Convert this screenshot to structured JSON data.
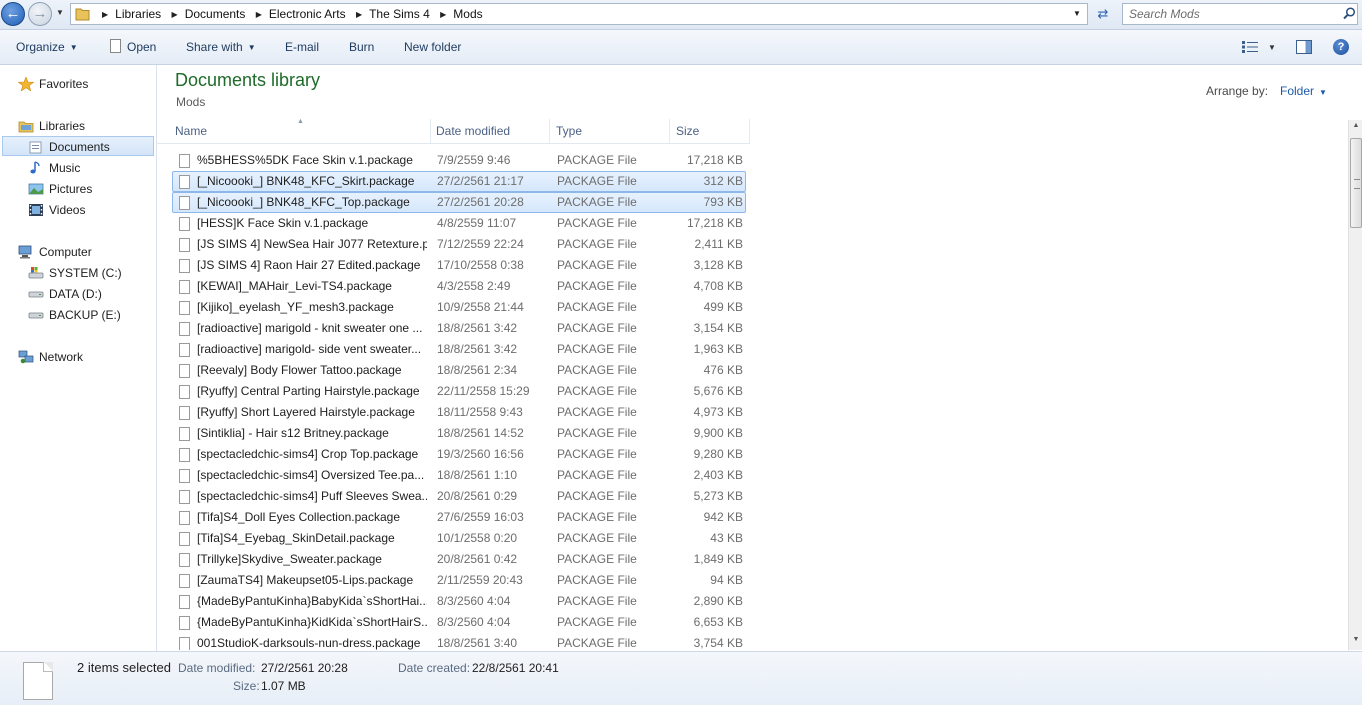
{
  "address": {
    "crumbs": [
      "Libraries",
      "Documents",
      "Electronic Arts",
      "The Sims 4",
      "Mods"
    ]
  },
  "search": {
    "placeholder": "Search Mods"
  },
  "toolbar": {
    "organize": "Organize",
    "open": "Open",
    "share_with": "Share with",
    "email": "E-mail",
    "burn": "Burn",
    "new_folder": "New folder"
  },
  "sidebar": {
    "favorites": "Favorites",
    "libraries": "Libraries",
    "documents": "Documents",
    "music": "Music",
    "pictures": "Pictures",
    "videos": "Videos",
    "computer": "Computer",
    "drive_c": "SYSTEM (C:)",
    "drive_d": "DATA (D:)",
    "drive_e": "BACKUP (E:)",
    "network": "Network"
  },
  "content": {
    "title": "Documents library",
    "subtitle": "Mods",
    "arrange_label": "Arrange by:",
    "arrange_value": "Folder"
  },
  "columns": {
    "name": "Name",
    "date": "Date modified",
    "type": "Type",
    "size": "Size"
  },
  "files": [
    {
      "name": "%5BHESS%5DK Face Skin v.1.package",
      "date": "7/9/2559 9:46",
      "type": "PACKAGE File",
      "size": "17,218 KB",
      "selected": false
    },
    {
      "name": "[_Nicoooki_] BNK48_KFC_Skirt.package",
      "date": "27/2/2561 21:17",
      "type": "PACKAGE File",
      "size": "312 KB",
      "selected": true
    },
    {
      "name": "[_Nicoooki_] BNK48_KFC_Top.package",
      "date": "27/2/2561 20:28",
      "type": "PACKAGE File",
      "size": "793 KB",
      "selected": true
    },
    {
      "name": "[HESS]K Face Skin v.1.package",
      "date": "4/8/2559 11:07",
      "type": "PACKAGE File",
      "size": "17,218 KB",
      "selected": false
    },
    {
      "name": "[JS SIMS 4] NewSea Hair J077 Retexture.p...",
      "date": "7/12/2559 22:24",
      "type": "PACKAGE File",
      "size": "2,411 KB",
      "selected": false
    },
    {
      "name": "[JS SIMS 4] Raon Hair 27 Edited.package",
      "date": "17/10/2558 0:38",
      "type": "PACKAGE File",
      "size": "3,128 KB",
      "selected": false
    },
    {
      "name": "[KEWAI]_MAHair_Levi-TS4.package",
      "date": "4/3/2558 2:49",
      "type": "PACKAGE File",
      "size": "4,708 KB",
      "selected": false
    },
    {
      "name": "[Kijiko]_eyelash_YF_mesh3.package",
      "date": "10/9/2558 21:44",
      "type": "PACKAGE File",
      "size": "499 KB",
      "selected": false
    },
    {
      "name": "[radioactive] marigold - knit sweater one ...",
      "date": "18/8/2561 3:42",
      "type": "PACKAGE File",
      "size": "3,154 KB",
      "selected": false
    },
    {
      "name": "[radioactive] marigold- side vent sweater...",
      "date": "18/8/2561 3:42",
      "type": "PACKAGE File",
      "size": "1,963 KB",
      "selected": false
    },
    {
      "name": "[Reevaly] Body Flower Tattoo.package",
      "date": "18/8/2561 2:34",
      "type": "PACKAGE File",
      "size": "476 KB",
      "selected": false
    },
    {
      "name": "[Ryuffy] Central Parting Hairstyle.package",
      "date": "22/11/2558 15:29",
      "type": "PACKAGE File",
      "size": "5,676 KB",
      "selected": false
    },
    {
      "name": "[Ryuffy] Short Layered Hairstyle.package",
      "date": "18/11/2558 9:43",
      "type": "PACKAGE File",
      "size": "4,973 KB",
      "selected": false
    },
    {
      "name": "[Sintiklia] - Hair s12 Britney.package",
      "date": "18/8/2561 14:52",
      "type": "PACKAGE File",
      "size": "9,900 KB",
      "selected": false
    },
    {
      "name": "[spectacledchic-sims4] Crop Top.package",
      "date": "19/3/2560 16:56",
      "type": "PACKAGE File",
      "size": "9,280 KB",
      "selected": false
    },
    {
      "name": "[spectacledchic-sims4] Oversized Tee.pa...",
      "date": "18/8/2561 1:10",
      "type": "PACKAGE File",
      "size": "2,403 KB",
      "selected": false
    },
    {
      "name": "[spectacledchic-sims4] Puff Sleeves Swea...",
      "date": "20/8/2561 0:29",
      "type": "PACKAGE File",
      "size": "5,273 KB",
      "selected": false
    },
    {
      "name": "[Tifa]S4_Doll Eyes Collection.package",
      "date": "27/6/2559 16:03",
      "type": "PACKAGE File",
      "size": "942 KB",
      "selected": false
    },
    {
      "name": "[Tifa]S4_Eyebag_SkinDetail.package",
      "date": "10/1/2558 0:20",
      "type": "PACKAGE File",
      "size": "43 KB",
      "selected": false
    },
    {
      "name": "[Trillyke]Skydive_Sweater.package",
      "date": "20/8/2561 0:42",
      "type": "PACKAGE File",
      "size": "1,849 KB",
      "selected": false
    },
    {
      "name": "[ZaumaTS4] Makeupset05-Lips.package",
      "date": "2/11/2559 20:43",
      "type": "PACKAGE File",
      "size": "94 KB",
      "selected": false
    },
    {
      "name": "{MadeByPantuKinha}BabyKida`sShortHai...",
      "date": "8/3/2560 4:04",
      "type": "PACKAGE File",
      "size": "2,890 KB",
      "selected": false
    },
    {
      "name": "{MadeByPantuKinha}KidKida`sShortHairS...",
      "date": "8/3/2560 4:04",
      "type": "PACKAGE File",
      "size": "6,653 KB",
      "selected": false
    },
    {
      "name": "001StudioK-darksouls-nun-dress.package",
      "date": "18/8/2561 3:40",
      "type": "PACKAGE File",
      "size": "3,754 KB",
      "selected": false
    }
  ],
  "details": {
    "selection": "2 items selected",
    "date_modified_label": "Date modified:",
    "date_modified": "27/2/2561 20:28",
    "date_created_label": "Date created:",
    "date_created": "22/8/2561 20:41",
    "size_label": "Size:",
    "size": "1.07 MB"
  },
  "colors": {
    "title_green": "#1e6b2a",
    "selection": "#d5e7fc",
    "link_blue": "#1e5aa8"
  }
}
